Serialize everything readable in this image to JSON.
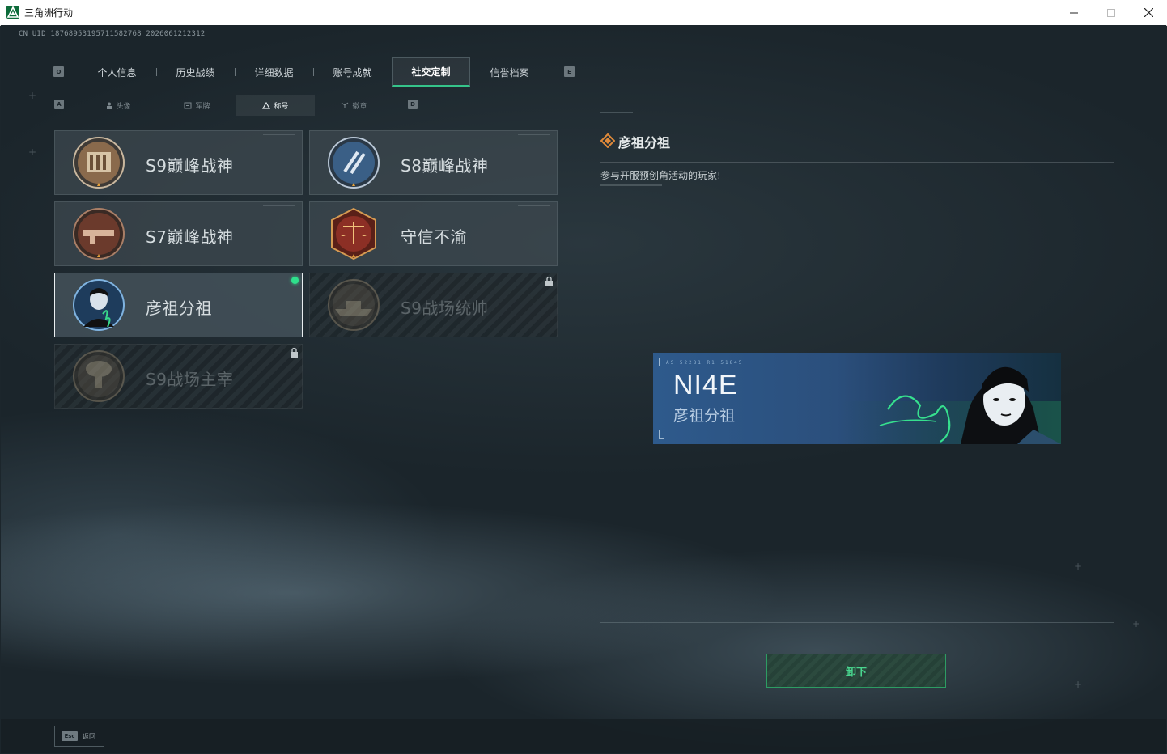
{
  "window": {
    "title": "三角洲行动",
    "controls": [
      "minimize",
      "maximize",
      "close"
    ]
  },
  "uid": "CN UID 18768953195711582768 2026061212312",
  "main_tabs": {
    "key_left": "Q",
    "key_right": "E",
    "items": [
      {
        "label": "个人信息",
        "active": false
      },
      {
        "label": "历史战绩",
        "active": false
      },
      {
        "label": "详细数据",
        "active": false
      },
      {
        "label": "账号成就",
        "active": false
      },
      {
        "label": "社交定制",
        "active": true
      },
      {
        "label": "信誉档案",
        "active": false
      }
    ]
  },
  "sub_tabs": {
    "key_left": "A",
    "key_right": "D",
    "items": [
      {
        "label": "头像",
        "icon": "person-icon",
        "active": false
      },
      {
        "label": "军牌",
        "icon": "dogtag-icon",
        "active": false
      },
      {
        "label": "称号",
        "icon": "triangle-icon",
        "active": true
      },
      {
        "label": "徽章",
        "icon": "emblem-icon",
        "active": false
      }
    ]
  },
  "titles": [
    {
      "name": "S9巅峰战神",
      "state": "owned",
      "badge_color": "#8a6a4c"
    },
    {
      "name": "S8巅峰战神",
      "state": "owned",
      "badge_color": "#3a5f86"
    },
    {
      "name": "S7巅峰战神",
      "state": "owned",
      "badge_color": "#6b3a2c"
    },
    {
      "name": "守信不渝",
      "state": "owned",
      "badge_color": "#8c2f25"
    },
    {
      "name": "彦祖分祖",
      "state": "equipped",
      "badge_color": "#2d5f8c"
    },
    {
      "name": "S9战场统帅",
      "state": "locked",
      "badge_color": "#5d5346"
    },
    {
      "name": "S9战场主宰",
      "state": "locked",
      "badge_color": "#5d5346"
    }
  ],
  "detail": {
    "name": "彦祖分祖",
    "description": "参与开服预创角活动的玩家!",
    "banner": {
      "code": "AS  52281   R1  51845",
      "big_text": "NI4E",
      "name": "彦祖分祖"
    }
  },
  "unequip_label": "卸下",
  "bottom": {
    "esc_key": "Esc",
    "back_label": "返回"
  },
  "colors": {
    "accent": "#35c48a",
    "equipped_dot": "#2fe08c"
  }
}
